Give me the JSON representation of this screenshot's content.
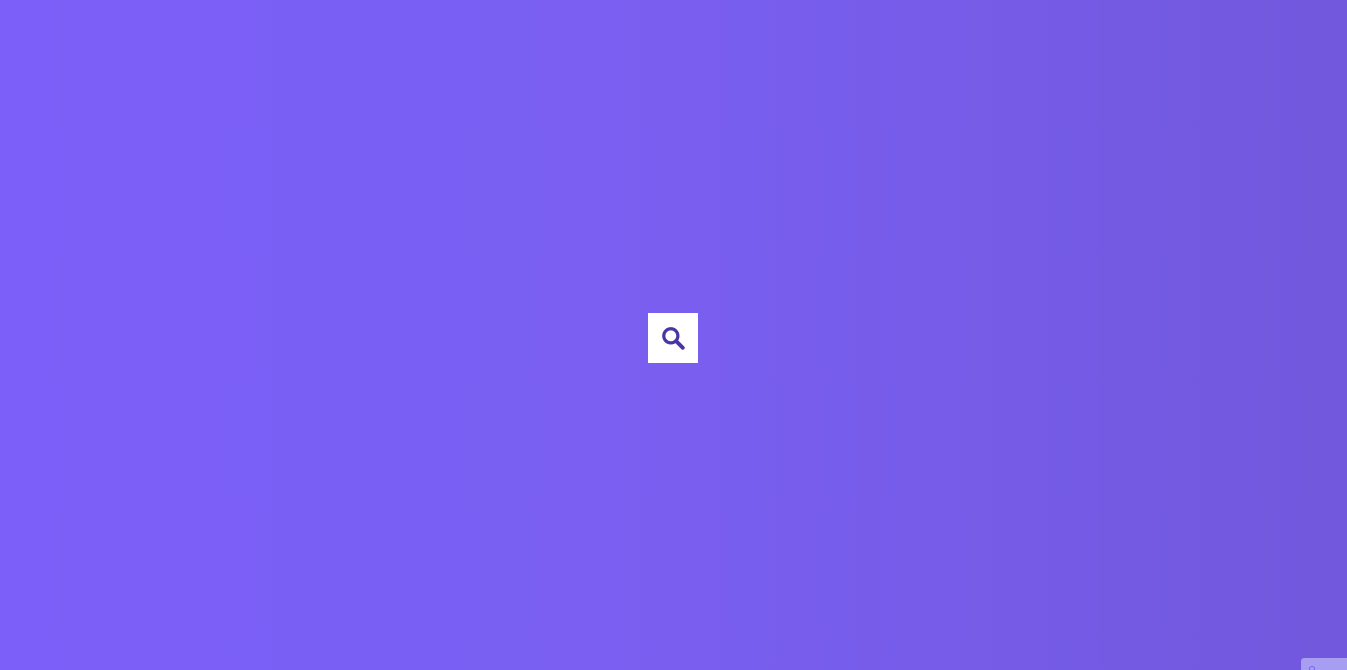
{
  "page": {
    "background_start": "#7b5ff8",
    "background_end": "#7158dc"
  },
  "search_button": {
    "icon": "search-icon",
    "icon_color": "#4a34a6",
    "background": "#ffffff"
  },
  "corner_widget": {
    "color": "#a79df1"
  }
}
